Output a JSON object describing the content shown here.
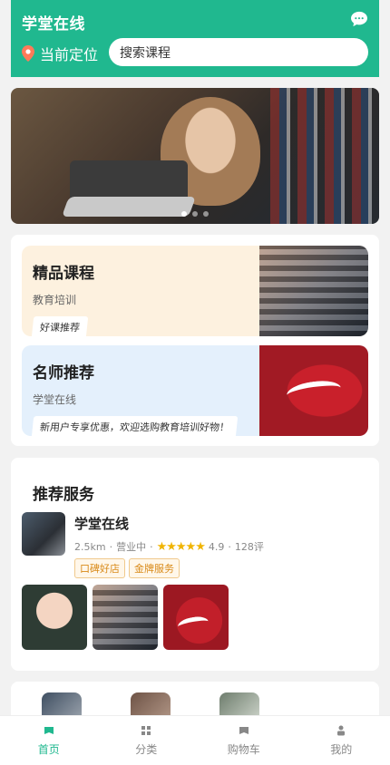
{
  "header": {
    "title": "学堂在线",
    "location_label": "当前定位",
    "search_placeholder": "搜索课程"
  },
  "banner": {
    "dots": 3,
    "active_dot": 1
  },
  "cards": [
    {
      "title": "精品课程",
      "subtitle": "教育培训",
      "tag": "好课推荐"
    },
    {
      "title": "名师推荐",
      "subtitle": "学堂在线",
      "tag": "新用户专享优惠，欢迎选购教育培训好物！"
    }
  ],
  "service": {
    "section_title": "推荐服务",
    "name": "学堂在线",
    "distance": "2.5km",
    "status": "营业中",
    "stars": "★★★★★",
    "rating": "4.9",
    "reviews": "128评",
    "tags": [
      "口碑好店",
      "金牌服务"
    ]
  },
  "tabbar": [
    {
      "label": "首页",
      "icon": "home-icon",
      "active": true
    },
    {
      "label": "分类",
      "icon": "grid-icon",
      "active": false
    },
    {
      "label": "购物车",
      "icon": "cart-icon",
      "active": false
    },
    {
      "label": "我的",
      "icon": "user-icon",
      "active": false
    }
  ],
  "colors": {
    "accent": "#20b88f",
    "star": "#f0b400",
    "tag": "#d98a19"
  }
}
